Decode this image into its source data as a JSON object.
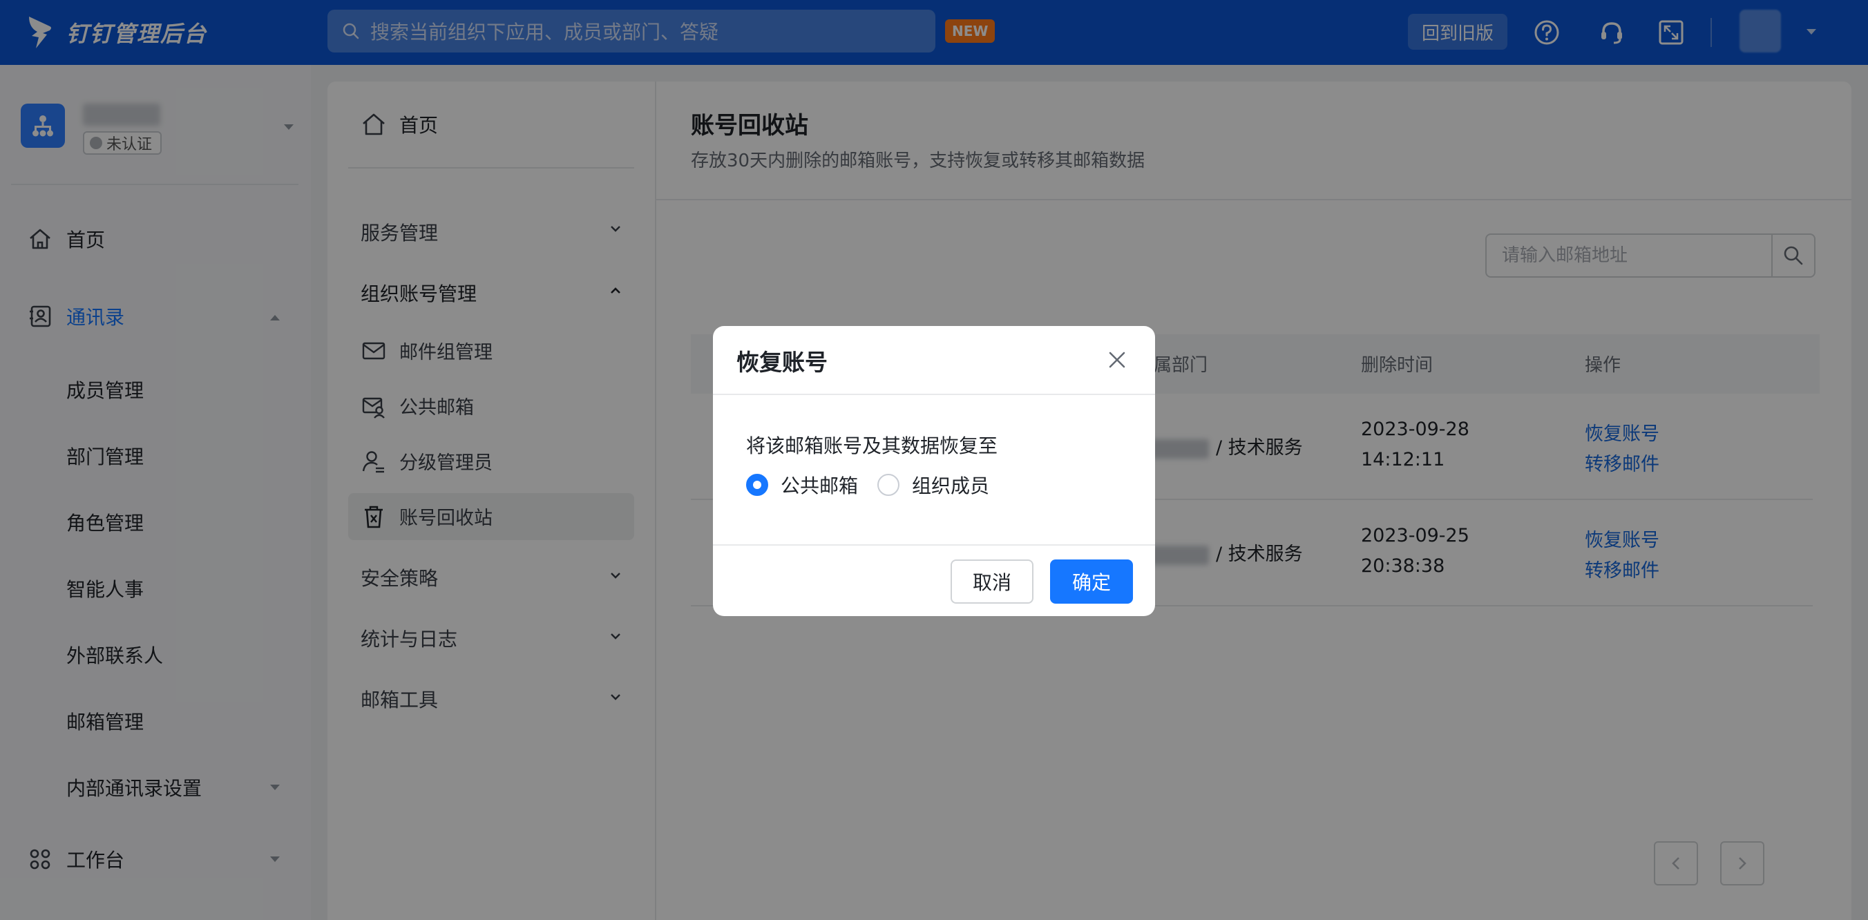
{
  "app": {
    "title": "钉钉管理后台"
  },
  "topbar": {
    "search_placeholder": "搜索当前组织下应用、成员或部门、答疑",
    "new_badge": "NEW",
    "back_old_label": "回到旧版"
  },
  "sidebar": {
    "org_badge": "未认证",
    "items": [
      {
        "label": "首页"
      },
      {
        "label": "通讯录"
      },
      {
        "label": "成员管理"
      },
      {
        "label": "部门管理"
      },
      {
        "label": "角色管理"
      },
      {
        "label": "智能人事"
      },
      {
        "label": "外部联系人"
      },
      {
        "label": "邮箱管理"
      },
      {
        "label": "内部通讯录设置"
      },
      {
        "label": "工作台"
      }
    ]
  },
  "subnav": {
    "home": "首页",
    "groups": [
      {
        "label": "服务管理"
      },
      {
        "label": "组织账号管理"
      },
      {
        "label": "安全策略"
      },
      {
        "label": "统计与日志"
      },
      {
        "label": "邮箱工具"
      }
    ],
    "items": [
      {
        "label": "邮件组管理"
      },
      {
        "label": "公共邮箱"
      },
      {
        "label": "分级管理员"
      },
      {
        "label": "账号回收站"
      }
    ]
  },
  "page": {
    "title": "账号回收站",
    "subtitle": "存放30天内删除的邮箱账号，支持恢复或转移其邮箱数据",
    "email_placeholder": "请输入邮箱地址"
  },
  "table": {
    "columns": [
      "所属部门",
      "删除时间",
      "操作"
    ],
    "rows": [
      {
        "dept": "/ 技术服务",
        "date": "2023-09-28",
        "time": "14:12:11",
        "action1": "恢复账号",
        "action2": "转移邮件"
      },
      {
        "dept": "/ 技术服务",
        "date": "2023-09-25",
        "time": "20:38:38",
        "action1": "恢复账号",
        "action2": "转移邮件"
      }
    ]
  },
  "modal": {
    "title": "恢复账号",
    "description": "将该邮箱账号及其数据恢复至",
    "options": [
      {
        "label": "公共邮箱",
        "selected": true
      },
      {
        "label": "组织成员",
        "selected": false
      }
    ],
    "cancel_label": "取消",
    "confirm_label": "确定"
  },
  "colors": {
    "topbar": "#0b57d6",
    "accent": "#1677ff",
    "link": "#1668dc",
    "new_badge": "#ff7a1a"
  }
}
